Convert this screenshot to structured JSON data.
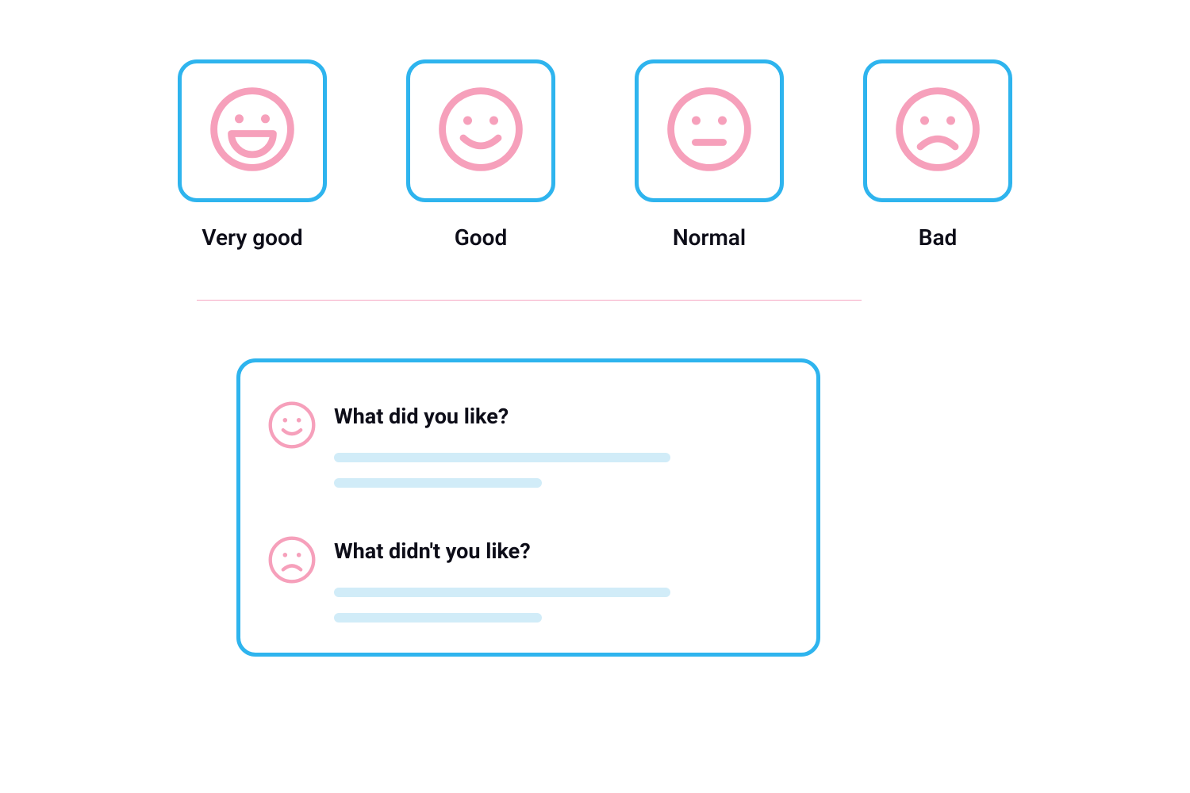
{
  "colors": {
    "border_blue": "#2eb4ee",
    "face_pink": "#f6a0bb",
    "divider_pink": "#f5a6c3",
    "placeholder_blue": "#d1ecf8",
    "text": "#0d0d18"
  },
  "ratings": [
    {
      "id": "very-good",
      "label": "Very good",
      "icon": "face-very-good"
    },
    {
      "id": "good",
      "label": "Good",
      "icon": "face-good"
    },
    {
      "id": "normal",
      "label": "Normal",
      "icon": "face-normal"
    },
    {
      "id": "bad",
      "label": "Bad",
      "icon": "face-bad"
    }
  ],
  "feedback": {
    "like": {
      "icon": "face-good-small",
      "title": "What did you like?"
    },
    "dislike": {
      "icon": "face-bad-small",
      "title": "What didn't you like?"
    }
  }
}
